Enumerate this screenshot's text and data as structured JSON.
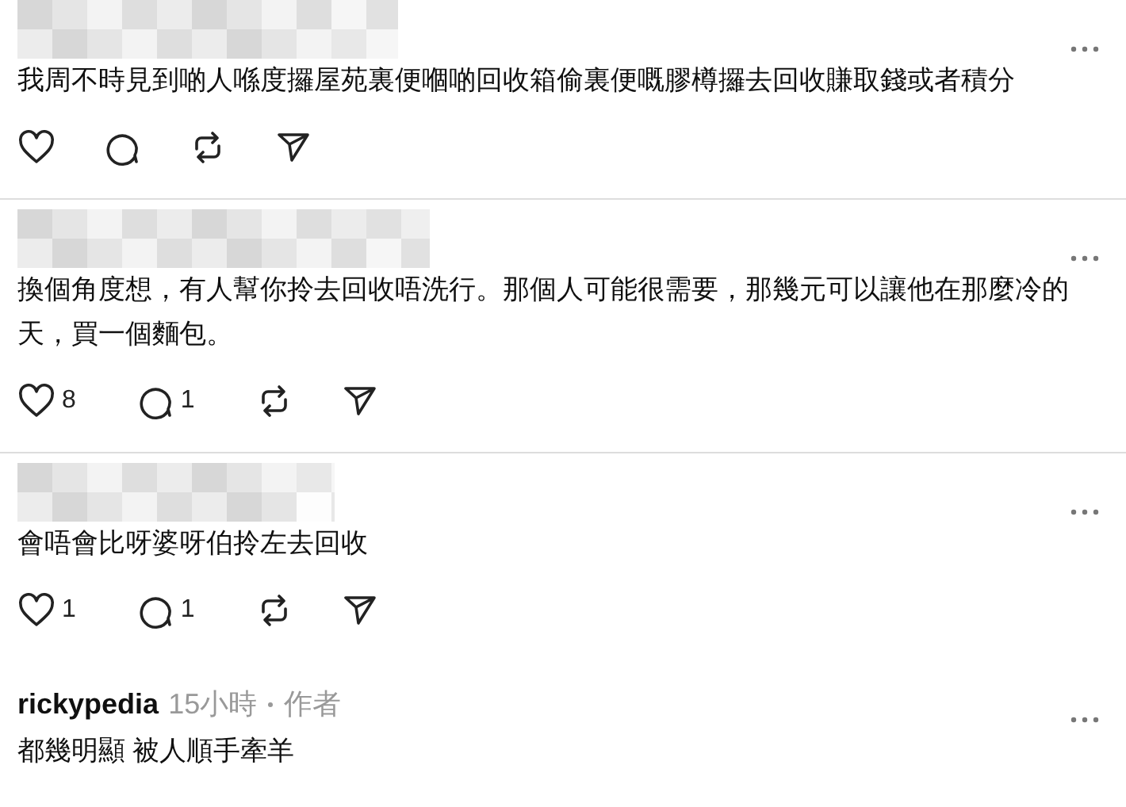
{
  "comments": [
    {
      "author": {
        "kind": "blurred"
      },
      "text": "我周不時見到啲人喺度攞屋苑裏便嗰啲回收箱偷裏便嘅膠樽攞去回收賺取錢或者積分",
      "actions": [
        {
          "kind": "like"
        },
        {
          "kind": "reply"
        },
        {
          "kind": "repost"
        },
        {
          "kind": "share"
        }
      ]
    },
    {
      "author": {
        "kind": "blurred"
      },
      "text": "換個角度想，有人幫你拎去回收唔洗行。那個人可能很需要，那幾元可以讓他在那麼冷的天，買一個麵包。",
      "actions": [
        {
          "kind": "like",
          "count": "8"
        },
        {
          "kind": "reply",
          "count": "1"
        },
        {
          "kind": "repost"
        },
        {
          "kind": "share"
        }
      ]
    },
    {
      "author": {
        "kind": "blurred"
      },
      "text": "會唔會比呀婆呀伯拎左去回收",
      "actions": [
        {
          "kind": "like",
          "count": "1"
        },
        {
          "kind": "reply",
          "count": "1"
        },
        {
          "kind": "repost"
        },
        {
          "kind": "share"
        }
      ]
    },
    {
      "author": {
        "kind": "named",
        "name": "rickypedia",
        "time": "15小時",
        "tag": "作者"
      },
      "text": "都幾明顯 被人順手牽羊"
    }
  ]
}
